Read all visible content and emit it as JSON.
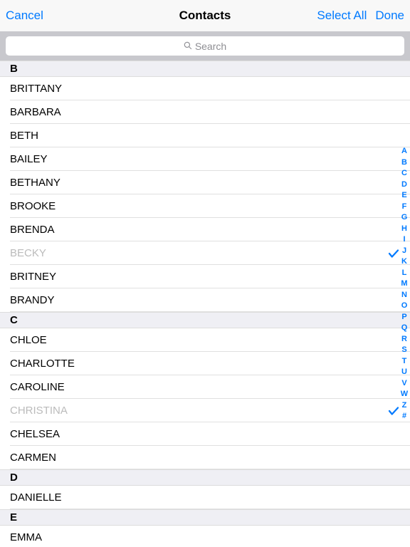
{
  "navbar": {
    "cancel": "Cancel",
    "title": "Contacts",
    "selectAll": "Select All",
    "done": "Done"
  },
  "search": {
    "placeholder": "Search"
  },
  "sections": [
    {
      "letter": "B",
      "contacts": [
        {
          "name": "BRITTANY",
          "selected": false
        },
        {
          "name": "BARBARA",
          "selected": false
        },
        {
          "name": "BETH",
          "selected": false
        },
        {
          "name": "BAILEY",
          "selected": false
        },
        {
          "name": "BETHANY",
          "selected": false
        },
        {
          "name": "BROOKE",
          "selected": false
        },
        {
          "name": "BRENDA",
          "selected": false
        },
        {
          "name": "BECKY",
          "selected": true
        },
        {
          "name": "BRITNEY",
          "selected": false
        },
        {
          "name": "BRANDY",
          "selected": false
        }
      ]
    },
    {
      "letter": "C",
      "contacts": [
        {
          "name": "CHLOE",
          "selected": false
        },
        {
          "name": "CHARLOTTE",
          "selected": false
        },
        {
          "name": "CAROLINE",
          "selected": false
        },
        {
          "name": "CHRISTINA",
          "selected": true
        },
        {
          "name": "CHELSEA",
          "selected": false
        },
        {
          "name": "CARMEN",
          "selected": false
        }
      ]
    },
    {
      "letter": "D",
      "contacts": [
        {
          "name": "DANIELLE",
          "selected": false
        }
      ]
    },
    {
      "letter": "E",
      "contacts": [
        {
          "name": "EMMA",
          "selected": false
        }
      ]
    }
  ],
  "indexLetters": [
    "A",
    "B",
    "C",
    "D",
    "E",
    "F",
    "G",
    "H",
    "I",
    "J",
    "K",
    "L",
    "M",
    "N",
    "O",
    "P",
    "Q",
    "R",
    "S",
    "T",
    "U",
    "V",
    "W",
    "Z",
    "#"
  ]
}
